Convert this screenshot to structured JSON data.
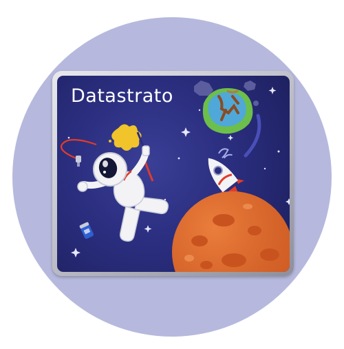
{
  "card": {
    "title": "Datastrato"
  },
  "colors": {
    "background_circle": "#b6b9dd",
    "space": "#2a2d7a",
    "planet": "#e06a2c",
    "rocket_flame": "#e23b2a",
    "paint": "#f0c42a"
  },
  "icons": [
    "astronaut-icon",
    "planet-icon",
    "rocket-icon",
    "asteroid-icon",
    "paint-splash-icon",
    "soda-can-icon",
    "star-icon"
  ]
}
